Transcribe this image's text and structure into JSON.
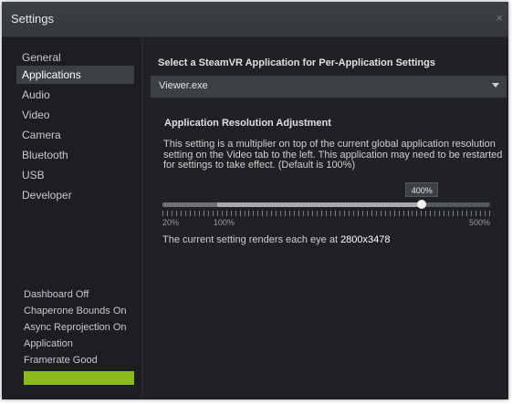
{
  "window": {
    "title": "Settings",
    "close_glyph": "×"
  },
  "sidebar": {
    "items": [
      {
        "label": "General",
        "active": false
      },
      {
        "label": "Applications",
        "active": true
      },
      {
        "label": "Audio",
        "active": false
      },
      {
        "label": "Video",
        "active": false
      },
      {
        "label": "Camera",
        "active": false
      },
      {
        "label": "Bluetooth",
        "active": false
      },
      {
        "label": "USB",
        "active": false
      },
      {
        "label": "Developer",
        "active": false
      }
    ],
    "status": {
      "lines": [
        "Dashboard Off",
        "Chaperone Bounds On",
        "Async Reprojection On",
        "Application",
        "Framerate Good"
      ],
      "indicator_color": "#89ba1a"
    }
  },
  "main": {
    "select_heading": "Select a SteamVR Application for Per-Application Settings",
    "app_select": {
      "value": "Viewer.exe"
    },
    "resolution": {
      "heading": "Application Resolution Adjustment",
      "description": "This setting is a multiplier on top of the current global application resolution setting on the Video tab to the left. This application may need to be restarted for settings to take effect. (Default is 100%)",
      "slider": {
        "min": 20,
        "max": 500,
        "default": 100,
        "value": 400,
        "value_label": "400%",
        "min_label": "20%",
        "default_label": "100%",
        "max_label": "500%"
      },
      "render_prefix": "The current setting renders each eye at ",
      "render_resolution": "2800x3478"
    }
  },
  "colors": {
    "window_bg": "#1c1e21",
    "titlebar_bg": "#3a3d41",
    "selected_bg": "#3c3f44",
    "accent_green": "#89ba1a"
  }
}
